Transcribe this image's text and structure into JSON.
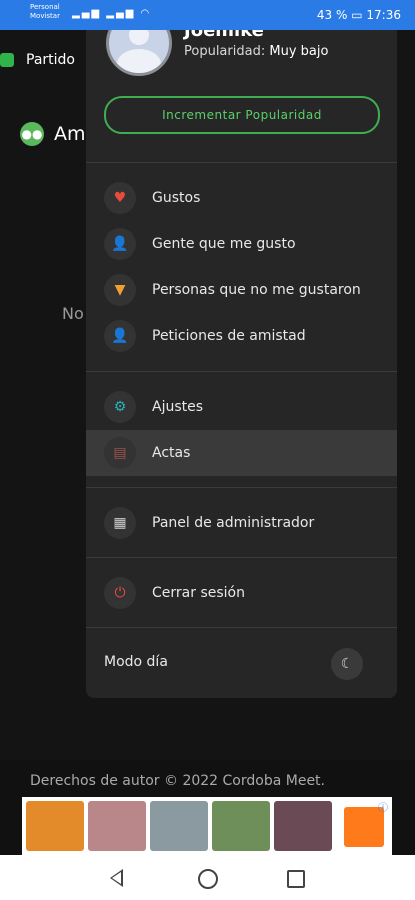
{
  "status_bar": {
    "carrier_line1": "Personal",
    "carrier_line2": "Movistar",
    "battery": "43 %",
    "time": "17:36"
  },
  "background": {
    "header_text": "Partido",
    "section_text": "Am",
    "empty_text": "No"
  },
  "drawer": {
    "user_name": "Joemike",
    "popularity_label": "Popularidad:",
    "popularity_value": "Muy bajo",
    "boost_button": "Incrementar Popularidad",
    "menu_items": [
      {
        "label": "Gustos",
        "icon": "heart-icon",
        "color": "#e74c3c"
      },
      {
        "label": "Gente que me gusto",
        "icon": "user-add-icon",
        "color": "#4caf50"
      },
      {
        "label": "Personas que no me gustaron",
        "icon": "thumbs-down-icon",
        "color": "#f0a030"
      },
      {
        "label": "Peticiones de amistad",
        "icon": "friend-request-icon",
        "color": "#4caf50"
      },
      {
        "label": "Ajustes",
        "icon": "gear-icon",
        "color": "#26b5b5"
      },
      {
        "label": "Actas",
        "icon": "minutes-icon",
        "color": "#a0524d"
      },
      {
        "label": "Panel de administrador",
        "icon": "dashboard-icon",
        "color": "#cfcfcf"
      },
      {
        "label": "Cerrar sesión",
        "icon": "power-icon",
        "color": "#e74c3c"
      }
    ],
    "theme_label": "Modo día"
  },
  "footer": {
    "copyright": "Derechos de autor © 2022 Cordoba Meet."
  }
}
